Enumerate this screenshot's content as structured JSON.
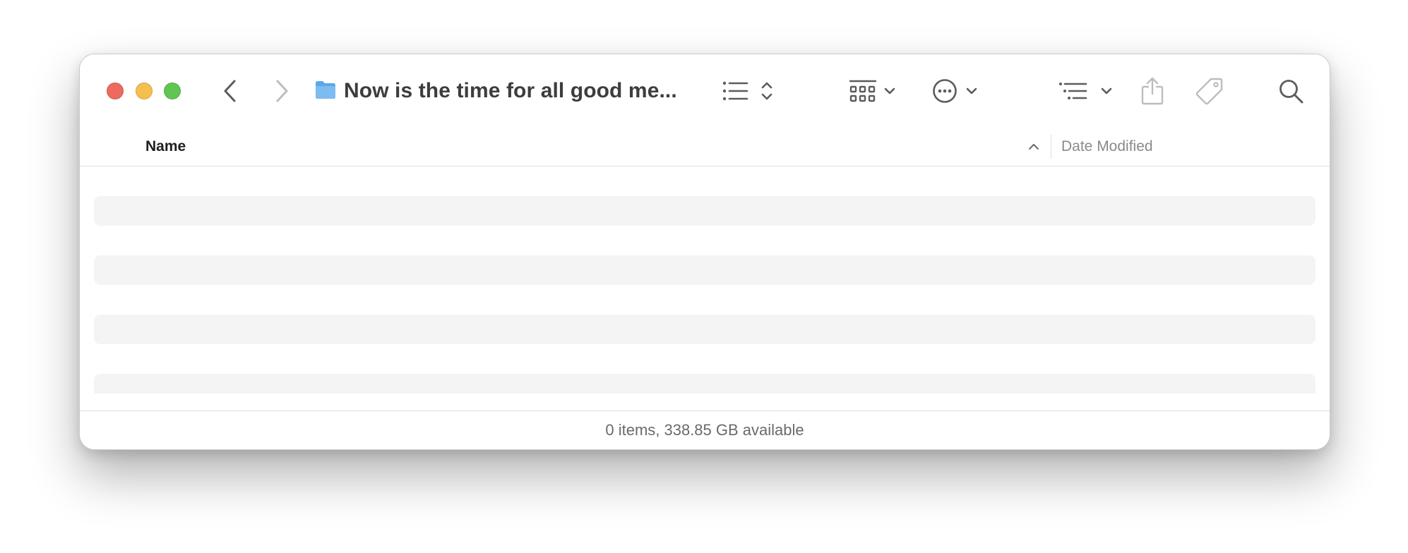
{
  "window": {
    "title": "Now is the time for all good me...",
    "controls": [
      "close",
      "minimize",
      "zoom"
    ]
  },
  "toolbar": {
    "buttons": [
      {
        "id": "back",
        "icon": "chevron-left-icon"
      },
      {
        "id": "forward",
        "icon": "chevron-right-icon"
      },
      {
        "id": "view",
        "icon": "list-view-icon"
      },
      {
        "id": "group",
        "icon": "grid-icon"
      },
      {
        "id": "action",
        "icon": "ellipsis-circle-icon"
      },
      {
        "id": "sort",
        "icon": "sort-lines-icon"
      },
      {
        "id": "share",
        "icon": "share-icon"
      },
      {
        "id": "tag",
        "icon": "tag-icon"
      },
      {
        "id": "search",
        "icon": "search-icon"
      }
    ]
  },
  "columns": {
    "name": "Name",
    "date_modified": "Date Modified",
    "sort_indicator": "ascending"
  },
  "status": {
    "text": "0 items, 338.85 GB available"
  },
  "colors": {
    "close": "#ec6a5e",
    "minimize": "#f4bf4f",
    "zoom": "#61c554",
    "folder": "#5aa8e8",
    "icon_gray": "#5c5c5c"
  }
}
